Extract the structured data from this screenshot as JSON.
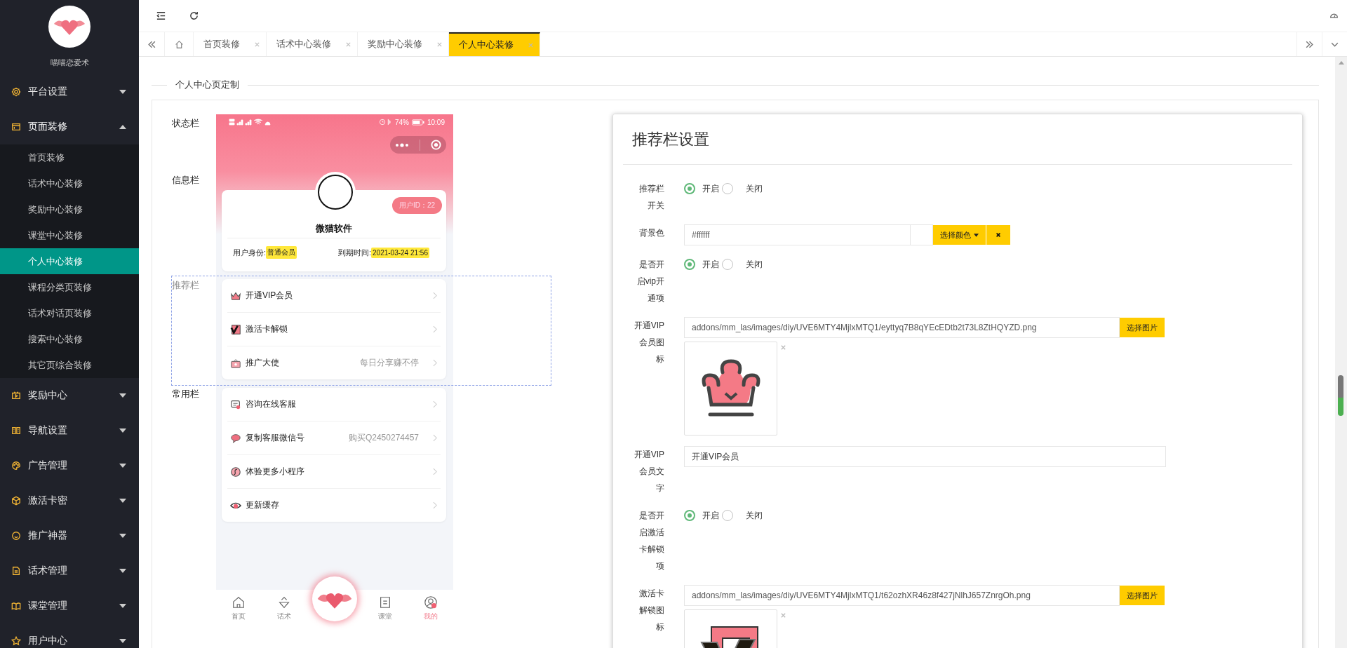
{
  "sidebar": {
    "brand": "喵喵恋爱术",
    "menu": [
      {
        "label": "平台设置",
        "expanded": false
      },
      {
        "label": "页面装修",
        "expanded": true,
        "children": [
          {
            "label": "首页装修",
            "selected": false
          },
          {
            "label": "话术中心装修",
            "selected": false
          },
          {
            "label": "奖励中心装修",
            "selected": false
          },
          {
            "label": "课堂中心装修",
            "selected": false
          },
          {
            "label": "个人中心装修",
            "selected": true
          },
          {
            "label": "课程分类页装修",
            "selected": false
          },
          {
            "label": "话术对话页装修",
            "selected": false
          },
          {
            "label": "搜索中心装修",
            "selected": false
          },
          {
            "label": "其它页综合装修",
            "selected": false
          }
        ]
      },
      {
        "label": "奖励中心",
        "expanded": false
      },
      {
        "label": "导航设置",
        "expanded": false
      },
      {
        "label": "广告管理",
        "expanded": false
      },
      {
        "label": "激活卡密",
        "expanded": false
      },
      {
        "label": "推广神器",
        "expanded": false
      },
      {
        "label": "话术管理",
        "expanded": false
      },
      {
        "label": "课堂管理",
        "expanded": false
      },
      {
        "label": "用户中心",
        "expanded": false
      }
    ]
  },
  "tabs": [
    {
      "label": "首页装修",
      "selected": false
    },
    {
      "label": "话术中心装修",
      "selected": false
    },
    {
      "label": "奖励中心装修",
      "selected": false
    },
    {
      "label": "个人中心装修",
      "selected": true
    }
  ],
  "section_title": "个人中心页定制",
  "preview": {
    "sections": [
      {
        "label": "状态栏",
        "selected": false
      },
      {
        "label": "信息栏",
        "selected": false
      },
      {
        "label": "推荐栏",
        "selected": true
      },
      {
        "label": "常用栏",
        "selected": false
      }
    ],
    "status_bar": {
      "battery": "74%",
      "time": "10:09"
    },
    "profile": {
      "user_id": "用户ID：22",
      "name": "微猫软件",
      "identity_label": "用户身份:",
      "identity": "普通会员",
      "expiry_label": "到期时间:",
      "expiry": "2021-03-24 21:56"
    },
    "recommend": [
      {
        "label": "开通VIP会员"
      },
      {
        "label": "激活卡解锁"
      },
      {
        "label": "推广大使",
        "note": "每日分享赚不停"
      }
    ],
    "common": [
      {
        "label": "咨询在线客服"
      },
      {
        "label": "复制客服微信号",
        "note": "购买Q2450274457"
      },
      {
        "label": "体验更多小程序"
      },
      {
        "label": "更新缓存"
      }
    ],
    "tabbar": [
      {
        "label": "首页",
        "selected": false
      },
      {
        "label": "话术",
        "selected": false
      },
      {
        "label": "课堂",
        "selected": false
      },
      {
        "label": "我的",
        "selected": true
      }
    ]
  },
  "settings": {
    "title": "推荐栏设置",
    "fields": [
      {
        "kind": "radio",
        "label": "推荐栏开关",
        "options": [
          {
            "label": "开启",
            "selected": true
          },
          {
            "label": "关闭",
            "selected": false
          }
        ]
      },
      {
        "kind": "color",
        "label": "背景色",
        "value": "#ffffff",
        "button": "选择颜色"
      },
      {
        "kind": "radio",
        "label": "是否开启vip开通项",
        "options": [
          {
            "label": "开启",
            "selected": true
          },
          {
            "label": "关闭",
            "selected": false
          }
        ]
      },
      {
        "kind": "image",
        "label": "开通VIP会员图标",
        "value": "addons/mm_las/images/diy/UVE6MTY4MjlxMTQ1/eyttyq7B8qYEcEDtb2t73L8ZtHQYZD.png",
        "button": "选择图片"
      },
      {
        "kind": "text",
        "label": "开通VIP会员文字",
        "value": "开通VIP会员"
      },
      {
        "kind": "radio",
        "label": "是否开启激活卡解锁项",
        "options": [
          {
            "label": "开启",
            "selected": true
          },
          {
            "label": "关闭",
            "selected": false
          }
        ]
      },
      {
        "kind": "image",
        "label": "激活卡解锁图标",
        "value": "addons/mm_las/images/diy/UVE6MTY4MjlxMTQ1/t62ozhXR46z8f427jNlhJ657ZnrgOh.png",
        "button": "选择图片"
      }
    ]
  }
}
